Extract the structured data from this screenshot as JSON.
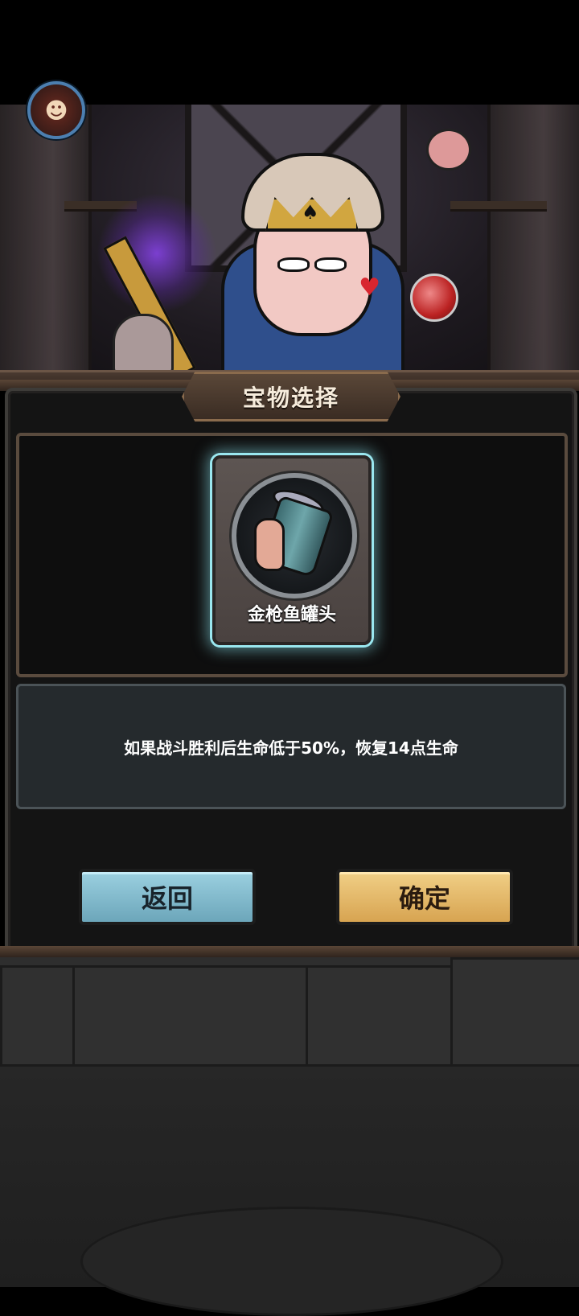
{
  "screen": {
    "title": "宝物选择",
    "item": {
      "name": "金枪鱼罐头",
      "icon": "tuna-can-icon"
    },
    "description": "如果战斗胜利后生命低于50%，恢复14点生命",
    "buttons": {
      "back_label": "返回",
      "confirm_label": "确定"
    }
  },
  "colors": {
    "back_button": "#7fb8cb",
    "confirm_button": "#e2b565",
    "item_glow": "#9ae7ef",
    "panel_bg": "#141414"
  }
}
